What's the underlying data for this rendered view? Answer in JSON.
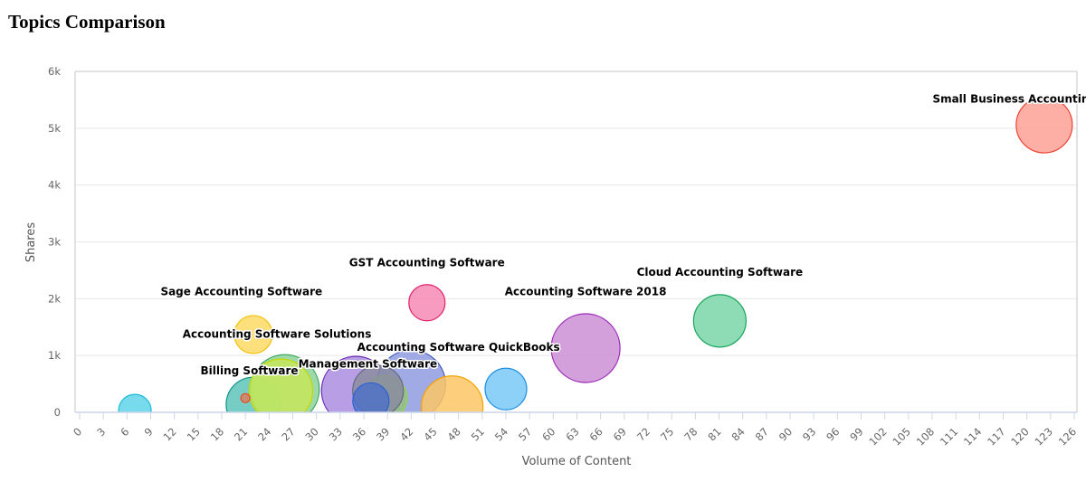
{
  "page": {
    "title": "Topics Comparison"
  },
  "chart_data": {
    "type": "bubble",
    "title": "Topics Comparison",
    "xlabel": "Volume of Content",
    "ylabel": "Shares",
    "xlim": [
      0,
      126
    ],
    "ylim": [
      0,
      6000
    ],
    "x_ticks": [
      0,
      3,
      6,
      9,
      12,
      15,
      18,
      21,
      24,
      27,
      30,
      33,
      36,
      39,
      42,
      45,
      48,
      51,
      54,
      57,
      60,
      63,
      66,
      69,
      72,
      75,
      78,
      81,
      84,
      87,
      90,
      93,
      96,
      99,
      102,
      105,
      108,
      111,
      114,
      117,
      120,
      123,
      126
    ],
    "y_ticks": [
      {
        "value": 0,
        "label": "0"
      },
      {
        "value": 1000,
        "label": "1k"
      },
      {
        "value": 2000,
        "label": "2k"
      },
      {
        "value": 3000,
        "label": "3k"
      },
      {
        "value": 4000,
        "label": "4k"
      },
      {
        "value": 5000,
        "label": "5k"
      },
      {
        "value": 6000,
        "label": "6k"
      }
    ],
    "grid": true,
    "legend": "none",
    "points": [
      {
        "label": "",
        "x": 7,
        "y": 30,
        "size": 18,
        "fill": "#5fd3ea",
        "stroke": "#17bcd8"
      },
      {
        "label": "",
        "x": 22,
        "y": 140,
        "size": 30,
        "fill": "#5ec4b8",
        "stroke": "#0f9485"
      },
      {
        "label": "",
        "x": 26,
        "y": 410,
        "size": 38,
        "fill": "#8dd49a",
        "stroke": "#3aa85a"
      },
      {
        "label": "Billing Software",
        "x": 25.5,
        "y": 380,
        "size": 35,
        "fill": "#c6e65a",
        "stroke": "#c2d800"
      },
      {
        "label": "",
        "x": 21,
        "y": 250,
        "size": 5,
        "fill": "#d98060",
        "stroke": "#e8482a"
      },
      {
        "label": "Sage Accounting Software",
        "x": 22,
        "y": 1370,
        "size": 21,
        "fill": "#fdd965",
        "stroke": "#f4c20d"
      },
      {
        "label": "Accounting Software Solutions",
        "x": 22,
        "y": 1370,
        "size": 0,
        "fill": "none",
        "stroke": "none"
      },
      {
        "label": "Management Software",
        "x": 35,
        "y": 380,
        "size": 38,
        "fill": "#ab8ee0",
        "stroke": "#6a2bb8"
      },
      {
        "label": "",
        "x": 42,
        "y": 490,
        "size": 38,
        "fill": "#8f9be0",
        "stroke": "#3a53b8"
      },
      {
        "label": "",
        "x": 38.6,
        "y": 250,
        "size": 25,
        "fill": "#95bf7f",
        "stroke": "#8fdc3a"
      },
      {
        "label": "",
        "x": 37.8,
        "y": 380,
        "size": 28,
        "fill": "#8a8ca0",
        "stroke": "#666a80"
      },
      {
        "label": "",
        "x": 36.9,
        "y": 200,
        "size": 20,
        "fill": "#5072c8",
        "stroke": "#2a62d0"
      },
      {
        "label": "",
        "x": 47.2,
        "y": 100,
        "size": 34,
        "fill": "#fdc766",
        "stroke": "#f4a300"
      },
      {
        "label": "",
        "x": 54,
        "y": 410,
        "size": 23,
        "fill": "#79c8f7",
        "stroke": "#1e8fe0"
      },
      {
        "label": "GST Accounting Software",
        "x": 44,
        "y": 1930,
        "size": 20,
        "fill": "#f78ab5",
        "stroke": "#e0226a"
      },
      {
        "label": "Accounting Software 2018",
        "x": 64.1,
        "y": 1130,
        "size": 38,
        "fill": "#cc8fd6",
        "stroke": "#9a2ab5"
      },
      {
        "label": "Accounting Software QuickBooks",
        "x": 64.1,
        "y": 1130,
        "size": 0,
        "fill": "none",
        "stroke": "none"
      },
      {
        "label": "Cloud Accounting Software",
        "x": 81.1,
        "y": 1610,
        "size": 29,
        "fill": "#79d6a8",
        "stroke": "#18a55a"
      },
      {
        "label": "Small Business Accounting Software",
        "x": 122.2,
        "y": 5060,
        "size": 31,
        "fill": "#fda197",
        "stroke": "#ee4433"
      }
    ],
    "annotations": [
      {
        "text": "Small Business Accounting Software",
        "x": 122.2,
        "y": 5450
      },
      {
        "text": "Cloud Accounting Software",
        "x": 81.1,
        "y": 2400
      },
      {
        "text": "Accounting Software 2018",
        "x": 64.1,
        "y": 2060
      },
      {
        "text": "GST Accounting Software",
        "x": 44,
        "y": 2570
      },
      {
        "text": "Sage Accounting Software",
        "x": 20.5,
        "y": 2060
      },
      {
        "text": "Accounting Software Solutions",
        "x": 25,
        "y": 1310
      },
      {
        "text": "Accounting Software QuickBooks",
        "x": 48,
        "y": 1080
      },
      {
        "text": "Billing Software",
        "x": 21.5,
        "y": 670
      },
      {
        "text": "Management Software",
        "x": 36.5,
        "y": 790
      }
    ]
  }
}
